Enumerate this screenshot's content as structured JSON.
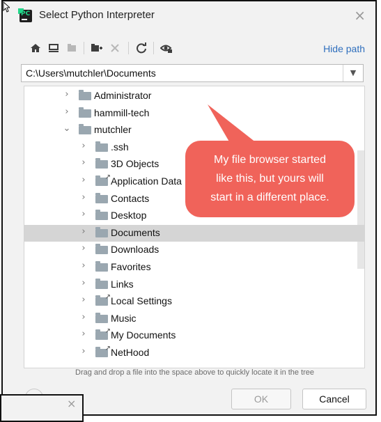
{
  "window": {
    "title": "Select Python Interpreter",
    "close_glyph": "×"
  },
  "toolbar": {
    "icons": [
      "home-icon",
      "desktop-icon",
      "project-icon",
      "new-folder-icon",
      "delete-icon",
      "refresh-icon",
      "show-hidden-icon"
    ],
    "hide_path_label": "Hide path"
  },
  "path": {
    "value": "C:\\Users\\mutchler\\Documents"
  },
  "tree": {
    "items": [
      {
        "label": "Administrator",
        "level": 1,
        "expanded": false,
        "shortcut": false,
        "selected": false
      },
      {
        "label": "hammill-tech",
        "level": 1,
        "expanded": false,
        "shortcut": false,
        "selected": false
      },
      {
        "label": "mutchler",
        "level": 1,
        "expanded": true,
        "shortcut": false,
        "selected": false
      },
      {
        "label": ".ssh",
        "level": 2,
        "expanded": false,
        "shortcut": false,
        "selected": false
      },
      {
        "label": "3D Objects",
        "level": 2,
        "expanded": false,
        "shortcut": false,
        "selected": false
      },
      {
        "label": "Application Data",
        "level": 2,
        "expanded": false,
        "shortcut": true,
        "selected": false
      },
      {
        "label": "Contacts",
        "level": 2,
        "expanded": false,
        "shortcut": false,
        "selected": false
      },
      {
        "label": "Desktop",
        "level": 2,
        "expanded": false,
        "shortcut": false,
        "selected": false
      },
      {
        "label": "Documents",
        "level": 2,
        "expanded": false,
        "shortcut": false,
        "selected": true
      },
      {
        "label": "Downloads",
        "level": 2,
        "expanded": false,
        "shortcut": false,
        "selected": false
      },
      {
        "label": "Favorites",
        "level": 2,
        "expanded": false,
        "shortcut": false,
        "selected": false
      },
      {
        "label": "Links",
        "level": 2,
        "expanded": false,
        "shortcut": false,
        "selected": false
      },
      {
        "label": "Local Settings",
        "level": 2,
        "expanded": false,
        "shortcut": true,
        "selected": false
      },
      {
        "label": "Music",
        "level": 2,
        "expanded": false,
        "shortcut": false,
        "selected": false
      },
      {
        "label": "My Documents",
        "level": 2,
        "expanded": false,
        "shortcut": true,
        "selected": false
      },
      {
        "label": "NetHood",
        "level": 2,
        "expanded": false,
        "shortcut": true,
        "selected": false
      }
    ]
  },
  "hint": "Drag and drop a file into the space above to quickly locate it in the tree",
  "buttons": {
    "ok": "OK",
    "cancel": "Cancel"
  },
  "callout": {
    "lines": [
      "My file browser started",
      "like this, but yours will",
      "start in a different place."
    ],
    "color": "#f0635a"
  },
  "colors": {
    "link": "#2f6fbd",
    "selection": "#d5d5d5",
    "folder": "#9aa7b0"
  }
}
